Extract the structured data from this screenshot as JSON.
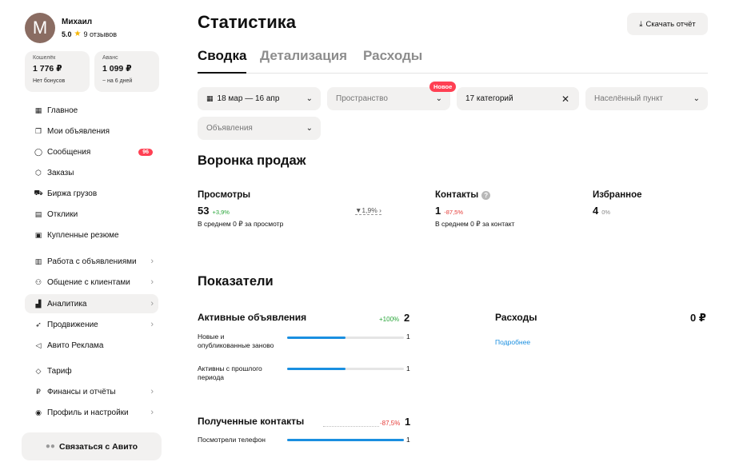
{
  "profile": {
    "initial": "М",
    "name": "Михаил",
    "rating": "5.0",
    "reviews": "9 отзывов"
  },
  "wallets": [
    {
      "label": "Кошелёк",
      "amount": "1 776 ₽",
      "sub": "Нет бонусов"
    },
    {
      "label": "Аванс",
      "amount": "1 099 ₽",
      "sub": "~ на 6 дней"
    }
  ],
  "nav": {
    "items": [
      {
        "label": "Главное",
        "icon": "grid-icon"
      },
      {
        "label": "Мои объявления",
        "icon": "documents-icon"
      },
      {
        "label": "Сообщения",
        "icon": "chat-icon",
        "badge": "96"
      },
      {
        "label": "Заказы",
        "icon": "box-icon"
      },
      {
        "label": "Биржа грузов",
        "icon": "truck-icon"
      },
      {
        "label": "Отклики",
        "icon": "responses-icon"
      },
      {
        "label": "Купленные резюме",
        "icon": "resume-icon"
      },
      {
        "label": "Работа с объявлениями",
        "icon": "board-icon"
      },
      {
        "label": "Общение с клиентами",
        "icon": "people-icon"
      },
      {
        "label": "Аналитика",
        "icon": "analytics-icon"
      },
      {
        "label": "Продвижение",
        "icon": "rocket-icon"
      },
      {
        "label": "Авито Реклама",
        "icon": "megaphone-icon"
      },
      {
        "label": "Тариф",
        "icon": "diamond-icon"
      },
      {
        "label": "Финансы и отчёты",
        "icon": "ruble-icon"
      },
      {
        "label": "Профиль и настройки",
        "icon": "profile-icon"
      }
    ],
    "contact_label": "Связаться с Авито"
  },
  "header": {
    "title": "Статистика",
    "download_label": "Скачать отчёт"
  },
  "tabs": [
    "Сводка",
    "Детализация",
    "Расходы"
  ],
  "filters": {
    "date": "18 мар — 16 апр",
    "space": "Пространство",
    "new_badge": "Новое",
    "categories": "17 категорий",
    "city": "Населённый пункт",
    "ads": "Объявления"
  },
  "funnel": {
    "title": "Воронка продаж",
    "views": {
      "name": "Просмотры",
      "value": "53",
      "delta": "+3,9%",
      "sub": "В среднем 0 ₽ за просмотр"
    },
    "conversion": "1,9%",
    "contacts": {
      "name": "Контакты",
      "value": "1",
      "delta": "-87,5%",
      "sub": "В среднем 0 ₽ за контакт"
    },
    "favorites": {
      "name": "Избранное",
      "value": "4",
      "delta": "0%"
    }
  },
  "indicators": {
    "title": "Показатели",
    "active": {
      "title": "Активные объявления",
      "delta": "+100%",
      "total": "2",
      "rows": [
        {
          "label": "Новые и опубликованные заново",
          "value": "1",
          "fill": 0.5
        },
        {
          "label": "Активны с прошлого периода",
          "value": "1",
          "fill": 0.5
        }
      ]
    },
    "expenses": {
      "title": "Расходы",
      "total": "0 ₽",
      "link": "Подробнее"
    },
    "contacts": {
      "title": "Полученные контакты",
      "delta": "-87,5%",
      "total": "1",
      "rows": [
        {
          "label": "Посмотрели телефон",
          "value": "1",
          "fill": 1.0
        }
      ]
    }
  }
}
